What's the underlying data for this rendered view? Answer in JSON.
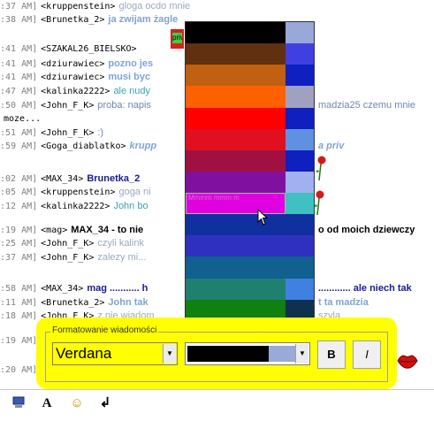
{
  "chat": {
    "lines": [
      {
        "ts": ":37 AM]",
        "nick": "<kruppenstein>",
        "msg": "gloga ocdo mnie",
        "style": "m-gray"
      },
      {
        "ts": ":38 AM]",
        "nick": "<Brunetka_2>",
        "msg": "ja zwijam żagle",
        "style": "m-lb"
      },
      {
        "ts": ":41 AM]",
        "nick": "<SZAKAL26_BIELSKO>",
        "msg": "",
        "style": "m-plain"
      },
      {
        "ts": ":41 AM]",
        "nick": "<dziurawiec>",
        "msg": "pozno jes",
        "style": "m-lb"
      },
      {
        "ts": ":41 AM]",
        "nick": "<dziurawiec>",
        "msg": "musi byc",
        "style": "m-lb"
      },
      {
        "ts": ":47 AM]",
        "nick": "<kalinka2222>",
        "msg": "ale nudy",
        "style": "m-teal"
      },
      {
        "ts": ":50 AM]",
        "nick": "<John_F_K>",
        "msg": "proba: napis",
        "tail": "madzia25 czemu mnie",
        "style": "m-plain"
      },
      {
        "ts": "",
        "nick": "moze...",
        "msg": "",
        "style": "m-plain"
      },
      {
        "ts": ":51 AM]",
        "nick": "<John_F_K>",
        "msg": ":)",
        "style": "m-plain"
      },
      {
        "ts": ":59 AM]",
        "nick": "<Goga_diablatko>",
        "msg": "krupp",
        "tail": "a priv",
        "style": "m-lb-i"
      },
      {
        "ts": ":02 AM]",
        "nick": "<MAX_34>",
        "msg": "Brunetka_2",
        "style": "m-dark"
      },
      {
        "ts": ":05 AM]",
        "nick": "<kruppenstein>",
        "msg": "goga ni",
        "style": "m-gray"
      },
      {
        "ts": ":12 AM]",
        "nick": "<kalinka2222>",
        "msg": "John bo",
        "style": "m-teal"
      },
      {
        "ts": ":19 AM]",
        "nick": "<mag>",
        "msg": "MAX_34 - to nie",
        "tail": "o od moich dziewczy",
        "style": "m-black"
      },
      {
        "ts": ":25 AM]",
        "nick": "<John_F_K>",
        "msg": "czyli kalink",
        "style": "m-gray"
      },
      {
        "ts": ":37 AM]",
        "nick": "<John_F_K>",
        "msg": "zalezy mi...",
        "style": "m-gray"
      },
      {
        "ts": ":58 AM]",
        "nick": "<MAX_34>",
        "msg": "mag ........... h",
        "tail": "............ ale niech tak",
        "style": "m-dark"
      },
      {
        "ts": ":11 AM]",
        "nick": "<Brunetka_2>",
        "msg": "John tak",
        "tail": "t ta madzia",
        "style": "m-lb"
      },
      {
        "ts": ":18 AM]",
        "nick": "<John_F_K>",
        "msg": "z nie wiadom",
        "tail": "szyla",
        "style": "m-gray"
      },
      {
        "ts": ":19 AM]",
        "nick": "",
        "msg": "",
        "style": "m-plain"
      },
      {
        "ts": ":20 AM]",
        "nick": "",
        "msg": "",
        "style": "m-plain"
      }
    ]
  },
  "popup_tag_text": "priv",
  "palette": {
    "colors": [
      {
        "main": "#000000",
        "side": "#98a8d8"
      },
      {
        "main": "#603010",
        "side": "#4040e0"
      },
      {
        "main": "#c06010",
        "side": "#1020c0"
      },
      {
        "main": "#ff6000",
        "side": "#a0a0c0"
      },
      {
        "main": "#ff0000",
        "side": "#1020c0"
      },
      {
        "main": "#e01020",
        "side": "#6090e0"
      },
      {
        "main": "#a01040",
        "side": "#1020c0"
      },
      {
        "main": "#8010a0",
        "side": "#a0b0f0"
      },
      {
        "main": "#e000e0",
        "side": "#40c0c0",
        "label": "Mmmm mmm m",
        "selected": true
      },
      {
        "main": "#1030a0",
        "side": "#1030a0"
      },
      {
        "main": "#3030c0",
        "side": "#3030c0"
      },
      {
        "main": "#106090",
        "side": "#106090"
      },
      {
        "main": "#208070",
        "side": "#4080e0"
      },
      {
        "main": "#108010",
        "side": "#103050"
      },
      {
        "main": "#888888",
        "side": "#b0d0f0"
      }
    ]
  },
  "format": {
    "title": "Formatowanie wiadomości",
    "font_value": "Verdana",
    "bold_label": "B",
    "italic_label": "I"
  },
  "toolbar": {
    "a_label": "A",
    "enter_label": "↲",
    "smile_label": "☺"
  }
}
